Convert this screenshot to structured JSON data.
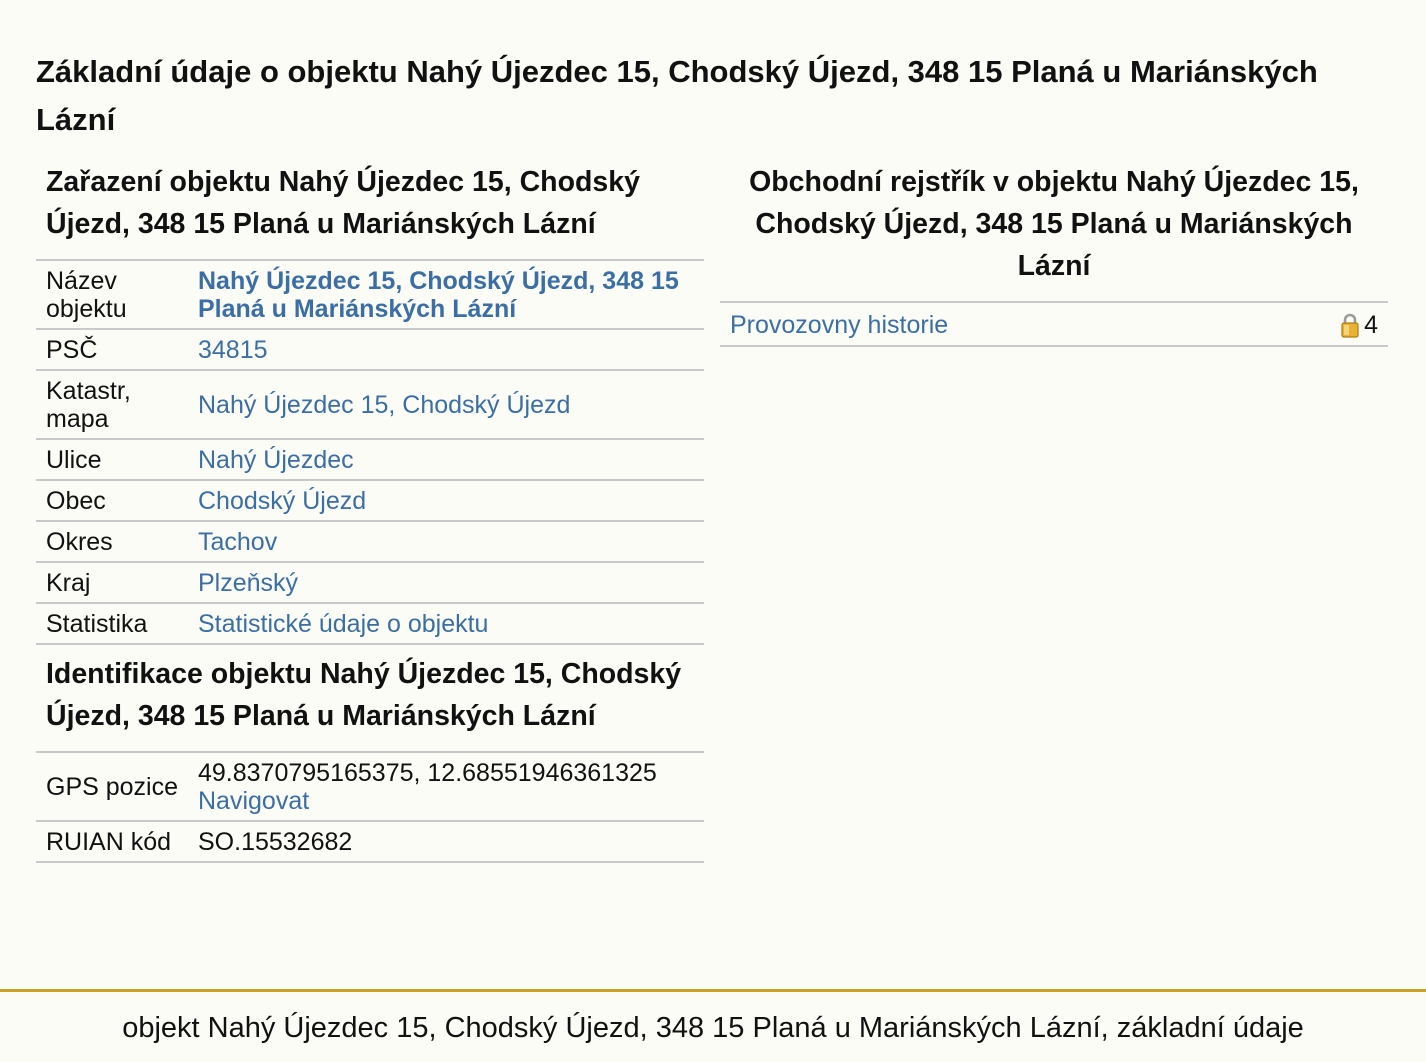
{
  "page_title": "Základní údaje o objektu Nahý Újezdec 15, Chodský Újezd, 348 15 Planá u Mariánských Lázní",
  "zarazeni": {
    "title": "Zařazení objektu Nahý Újezdec 15, Chodský Újezd, 348 15 Planá u Mariánských Lázní",
    "rows": [
      {
        "label": "Název objektu",
        "value": "Nahý Újezdec 15, Chodský Újezd, 348 15 Planá u Mariánských Lázní"
      },
      {
        "label": "PSČ",
        "value": "34815"
      },
      {
        "label": "Katastr, mapa",
        "value": "Nahý Újezdec 15, Chodský Újezd"
      },
      {
        "label": "Ulice",
        "value": "Nahý Újezdec"
      },
      {
        "label": "Obec",
        "value": "Chodský Újezd"
      },
      {
        "label": "Okres",
        "value": "Tachov"
      },
      {
        "label": "Kraj",
        "value": "Plzeňský"
      },
      {
        "label": "Statistika",
        "value": "Statistické údaje o objektu"
      }
    ]
  },
  "identifikace": {
    "title": "Identifikace objektu Nahý Újezdec 15, Chodský Újezd, 348 15 Planá u Mariánských Lázní",
    "gps": {
      "label": "GPS pozice",
      "value": "49.8370795165375, 12.68551946361325",
      "link": "Navigovat"
    },
    "ruian": {
      "label": "RUIAN kód",
      "value": "SO.15532682"
    }
  },
  "obchodni_rejstrik": {
    "title": "Obchodní rejstřík v objektu Nahý Újezdec 15, Chodský Újezd, 348 15 Planá u Mariánských Lázní",
    "rows": [
      {
        "label": "Provozovny historie",
        "count": "4",
        "icon": "lock-icon"
      }
    ]
  },
  "footer": "objekt Nahý Újezdec 15, Chodský Újezd, 348 15 Planá u Mariánských Lázní, základní údaje",
  "colors": {
    "link": "#3a6ea5",
    "footer_line": "#c9a227",
    "background": "#fcfcf7"
  }
}
